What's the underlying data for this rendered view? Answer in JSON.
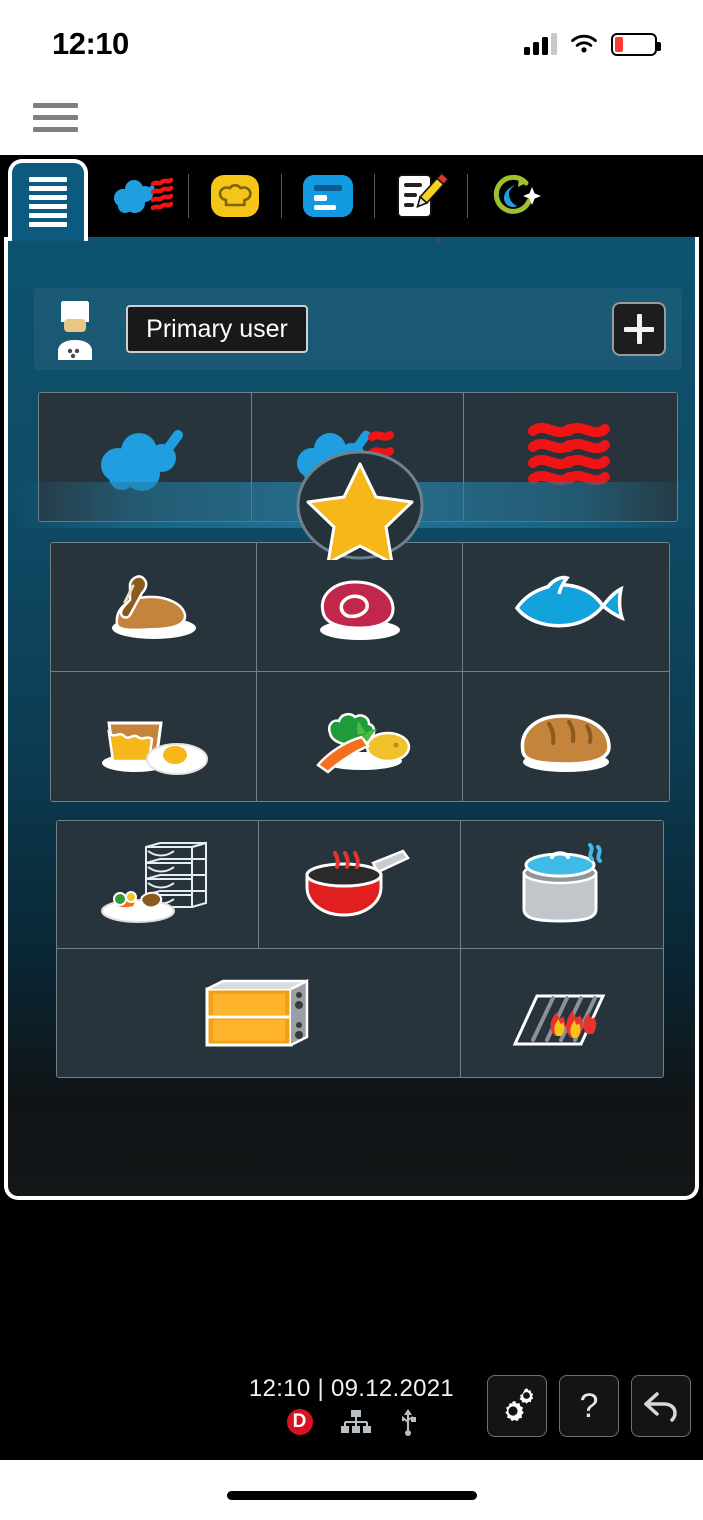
{
  "status_bar": {
    "time": "12:10",
    "cellular_icon": "cellular-signal-icon",
    "wifi_icon": "wifi-icon",
    "battery_icon": "battery-low-icon",
    "battery_level_percent": 22
  },
  "nav": {
    "menu_icon": "hamburger-menu-icon"
  },
  "tabs": {
    "active_tab": {
      "name": "overview-list",
      "icon": "list-lines-icon",
      "selected": true
    },
    "items": [
      {
        "name": "combi-steam",
        "icon": "steam-heat-icon",
        "selected": false
      },
      {
        "name": "chef-assist",
        "icon": "chef-hat-icon",
        "selected": false
      },
      {
        "name": "programs",
        "icon": "program-list-icon",
        "selected": false
      },
      {
        "name": "manual-edit",
        "icon": "notepad-pencil-icon",
        "selected": false
      },
      {
        "name": "cleaning",
        "icon": "clean-cycle-icon",
        "selected": false
      }
    ]
  },
  "user_bar": {
    "avatar_icon": "chef-avatar-icon",
    "user_name": "Primary user",
    "add_button_label": "+"
  },
  "modes_grid": {
    "cells": [
      {
        "name": "steam-mode",
        "icon": "steam-icon"
      },
      {
        "name": "combination-mode",
        "icon": "steam-plus-heat-icon"
      },
      {
        "name": "convection-heat-mode",
        "icon": "dry-heat-icon"
      }
    ]
  },
  "favorites": {
    "name": "favorites-star",
    "icon": "star-icon"
  },
  "food_grid": {
    "cells": [
      {
        "name": "poultry",
        "icon": "chicken-leg-icon"
      },
      {
        "name": "meat",
        "icon": "steak-icon"
      },
      {
        "name": "fish",
        "icon": "fish-icon"
      },
      {
        "name": "egg-dessert",
        "icon": "flan-egg-icon"
      },
      {
        "name": "vegetables-side-dishes",
        "icon": "vegetables-icon"
      },
      {
        "name": "bakery-bread",
        "icon": "bread-loaf-icon"
      }
    ]
  },
  "tools_grid": {
    "cells": [
      {
        "name": "finishing",
        "icon": "banquet-rack-plate-icon"
      },
      {
        "name": "pan-frying",
        "icon": "frying-pan-icon"
      },
      {
        "name": "boiling-pot",
        "icon": "pot-with-lid-icon"
      },
      {
        "name": "oven-unit",
        "icon": "oven-appliance-icon"
      },
      {
        "name": "grill",
        "icon": "grill-flames-icon"
      }
    ]
  },
  "device_footer": {
    "datetime": "12:10 | 09.12.2021",
    "status_icons": [
      {
        "name": "delta-badge",
        "label": "D",
        "color": "#d81222"
      },
      {
        "name": "network-icon"
      },
      {
        "name": "usb-icon"
      }
    ],
    "buttons": [
      {
        "name": "settings-button",
        "icon": "gears-icon"
      },
      {
        "name": "help-button",
        "icon": "question-mark-icon",
        "label": "?"
      },
      {
        "name": "back-button",
        "icon": "back-arrow-icon"
      }
    ]
  },
  "colors": {
    "panel_top": "#0d536f",
    "panel_bottom": "#141718",
    "tab_active": "#0d5a80",
    "cell_bg": "#27343c",
    "cell_border": "#6f8088",
    "steam_blue": "#1f9fe0",
    "heat_red": "#f11414",
    "chef_hat_yellow": "#f5c517",
    "star_yellow": "#f5b719",
    "alert_red": "#d81222"
  }
}
